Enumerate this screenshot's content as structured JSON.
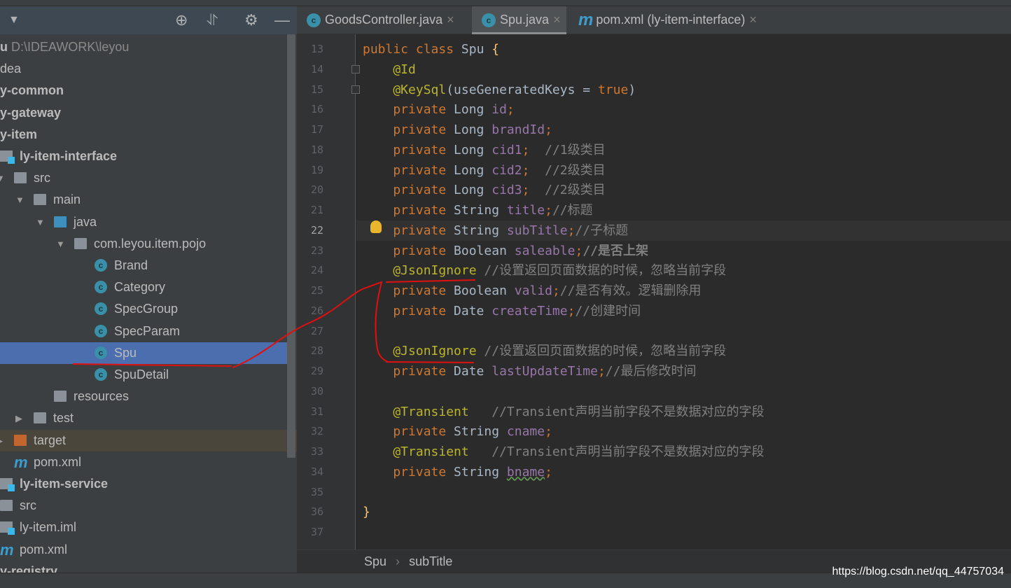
{
  "project_panel": {
    "tree": [
      {
        "depth": 0,
        "icon": "none",
        "parts": [
          {
            "text": "u",
            "s": "b"
          },
          {
            "text": " D:\\IDEAWORK\\leyou",
            "s": "g"
          }
        ]
      },
      {
        "depth": 0,
        "icon": "none",
        "parts": [
          {
            "text": "dea",
            "s": ""
          }
        ]
      },
      {
        "depth": 0,
        "icon": "none",
        "parts": [
          {
            "text": "y-common",
            "s": "b"
          }
        ]
      },
      {
        "depth": 0,
        "icon": "none",
        "parts": [
          {
            "text": "y-gateway",
            "s": "b"
          }
        ]
      },
      {
        "depth": 0,
        "icon": "none",
        "parts": [
          {
            "text": "y-item",
            "s": "b"
          }
        ]
      },
      {
        "depth": 1,
        "icon": "module",
        "parts": [
          {
            "text": "ly-item-interface",
            "s": "b"
          }
        ]
      },
      {
        "depth": 2,
        "icon": "folder",
        "arrow": "expanded",
        "parts": [
          {
            "text": "src",
            "s": ""
          }
        ]
      },
      {
        "depth": 3,
        "icon": "folder",
        "arrow": "expanded",
        "parts": [
          {
            "text": "main",
            "s": ""
          }
        ]
      },
      {
        "depth": 4,
        "icon": "folder-blue",
        "arrow": "expanded",
        "parts": [
          {
            "text": "java",
            "s": ""
          }
        ]
      },
      {
        "depth": 5,
        "icon": "package",
        "arrow": "expanded",
        "parts": [
          {
            "text": "com.leyou.item.pojo",
            "s": ""
          }
        ]
      },
      {
        "depth": 6,
        "icon": "class",
        "parts": [
          {
            "text": "Brand",
            "s": ""
          }
        ]
      },
      {
        "depth": 6,
        "icon": "class",
        "parts": [
          {
            "text": "Category",
            "s": ""
          }
        ]
      },
      {
        "depth": 6,
        "icon": "class",
        "parts": [
          {
            "text": "SpecGroup",
            "s": ""
          }
        ]
      },
      {
        "depth": 6,
        "icon": "class",
        "parts": [
          {
            "text": "SpecParam",
            "s": ""
          }
        ]
      },
      {
        "depth": 6,
        "icon": "class",
        "selected": true,
        "parts": [
          {
            "text": "Spu",
            "s": ""
          }
        ]
      },
      {
        "depth": 6,
        "icon": "class",
        "parts": [
          {
            "text": "SpuDetail",
            "s": ""
          }
        ]
      },
      {
        "depth": 4,
        "icon": "resources",
        "parts": [
          {
            "text": "resources",
            "s": ""
          }
        ]
      },
      {
        "depth": 3,
        "icon": "folder",
        "arrow": "collapsed",
        "parts": [
          {
            "text": "test",
            "s": ""
          }
        ]
      },
      {
        "depth": 2,
        "icon": "folder-orange",
        "arrow": "collapsed",
        "highlight": true,
        "parts": [
          {
            "text": "target",
            "s": ""
          }
        ]
      },
      {
        "depth": 2,
        "icon": "maven",
        "parts": [
          {
            "text": "pom.xml",
            "s": ""
          }
        ]
      },
      {
        "depth": 1,
        "icon": "module",
        "parts": [
          {
            "text": "ly-item-service",
            "s": "b"
          }
        ]
      },
      {
        "depth": 1,
        "icon": "folder",
        "parts": [
          {
            "text": "src",
            "s": ""
          }
        ]
      },
      {
        "depth": 1,
        "icon": "iml",
        "parts": [
          {
            "text": "ly-item.iml",
            "s": ""
          }
        ]
      },
      {
        "depth": 1,
        "icon": "maven",
        "parts": [
          {
            "text": "pom.xml",
            "s": ""
          }
        ]
      },
      {
        "depth": 0,
        "icon": "none",
        "parts": [
          {
            "text": "y-registry",
            "s": "b"
          }
        ]
      }
    ],
    "header_icons": [
      "dropdown-icon",
      "locate-icon",
      "collapse-all-icon",
      "gear-icon",
      "minimize-icon"
    ]
  },
  "tabs": [
    {
      "label": "GoodsController.java",
      "icon": "java-class-icon",
      "active": false
    },
    {
      "label": "Spu.java",
      "icon": "java-class-icon",
      "active": true
    },
    {
      "label": "pom.xml (ly-item-interface)",
      "icon": "maven-icon",
      "active": false
    }
  ],
  "editor": {
    "current_line": 22,
    "lines": [
      {
        "n": 13,
        "t": [
          [
            "kw",
            "public class "
          ],
          [
            "ty",
            "Spu "
          ],
          [
            "br",
            "{"
          ]
        ]
      },
      {
        "n": 14,
        "t": [
          [
            "an",
            "    @Id"
          ]
        ]
      },
      {
        "n": 15,
        "t": [
          [
            "an",
            "    @KeySql"
          ],
          [
            "ty",
            "(useGeneratedKeys = "
          ],
          [
            "kw",
            "true"
          ],
          [
            "ty",
            ")"
          ]
        ]
      },
      {
        "n": 16,
        "t": [
          [
            "kw",
            "    private "
          ],
          [
            "ty",
            "Long "
          ],
          [
            "fd",
            "id"
          ],
          [
            "pn",
            ";"
          ]
        ]
      },
      {
        "n": 17,
        "t": [
          [
            "kw",
            "    private "
          ],
          [
            "ty",
            "Long "
          ],
          [
            "fd",
            "brandId"
          ],
          [
            "pn",
            ";"
          ]
        ]
      },
      {
        "n": 18,
        "t": [
          [
            "kw",
            "    private "
          ],
          [
            "ty",
            "Long "
          ],
          [
            "fd",
            "cid1"
          ],
          [
            "pn",
            ";"
          ],
          [
            "cm",
            "  //1级类目"
          ]
        ]
      },
      {
        "n": 19,
        "t": [
          [
            "kw",
            "    private "
          ],
          [
            "ty",
            "Long "
          ],
          [
            "fd",
            "cid2"
          ],
          [
            "pn",
            ";"
          ],
          [
            "cm",
            "  //2级类目"
          ]
        ]
      },
      {
        "n": 20,
        "t": [
          [
            "kw",
            "    private "
          ],
          [
            "ty",
            "Long "
          ],
          [
            "fd",
            "cid3"
          ],
          [
            "pn",
            ";"
          ],
          [
            "cm",
            "  //2级类目"
          ]
        ]
      },
      {
        "n": 21,
        "t": [
          [
            "kw",
            "    private "
          ],
          [
            "ty",
            "String "
          ],
          [
            "fd",
            "title"
          ],
          [
            "pn",
            ";"
          ],
          [
            "cm",
            "//标题"
          ]
        ]
      },
      {
        "n": 22,
        "t": [
          [
            "kw",
            "    private "
          ],
          [
            "ty",
            "String "
          ],
          [
            "fd",
            "subTitle"
          ],
          [
            "pn",
            ";"
          ],
          [
            "cm",
            "//子标题"
          ]
        ]
      },
      {
        "n": 23,
        "t": [
          [
            "kw",
            "    private "
          ],
          [
            "ty",
            "Boolean "
          ],
          [
            "fd",
            "saleable"
          ],
          [
            "pn",
            ";"
          ],
          [
            "cmb",
            "//是否上架"
          ]
        ]
      },
      {
        "n": 24,
        "t": [
          [
            "an",
            "    @JsonIgnore "
          ],
          [
            "cm",
            "//设置返回页面数据的时候，忽略当前字段"
          ]
        ]
      },
      {
        "n": 25,
        "t": [
          [
            "kw",
            "    private "
          ],
          [
            "ty",
            "Boolean "
          ],
          [
            "fd",
            "valid"
          ],
          [
            "pn",
            ";"
          ],
          [
            "cm",
            "//是否有效。逻辑删除用"
          ]
        ]
      },
      {
        "n": 26,
        "t": [
          [
            "kw",
            "    private "
          ],
          [
            "ty",
            "Date "
          ],
          [
            "fd",
            "createTime"
          ],
          [
            "pn",
            ";"
          ],
          [
            "cm",
            "//创建时间"
          ]
        ]
      },
      {
        "n": 27,
        "t": []
      },
      {
        "n": 28,
        "t": [
          [
            "an",
            "    @JsonIgnore "
          ],
          [
            "cm",
            "//设置返回页面数据的时候，忽略当前字段"
          ]
        ]
      },
      {
        "n": 29,
        "t": [
          [
            "kw",
            "    private "
          ],
          [
            "ty",
            "Date "
          ],
          [
            "fd",
            "lastUpdateTime"
          ],
          [
            "pn",
            ";"
          ],
          [
            "cm",
            "//最后修改时间"
          ]
        ]
      },
      {
        "n": 30,
        "t": []
      },
      {
        "n": 31,
        "t": [
          [
            "an",
            "    @Transient   "
          ],
          [
            "cm",
            "//Transient声明当前字段不是数据对应的字段"
          ]
        ]
      },
      {
        "n": 32,
        "t": [
          [
            "kw",
            "    private "
          ],
          [
            "ty",
            "String "
          ],
          [
            "fd",
            "cname"
          ],
          [
            "pn",
            ";"
          ]
        ]
      },
      {
        "n": 33,
        "t": [
          [
            "an",
            "    @Transient   "
          ],
          [
            "cm",
            "//Transient声明当前字段不是数据对应的字段"
          ]
        ]
      },
      {
        "n": 34,
        "t": [
          [
            "kw",
            "    private "
          ],
          [
            "ty",
            "String "
          ],
          [
            "fd squig",
            "bname"
          ],
          [
            "pn",
            ";"
          ]
        ]
      },
      {
        "n": 35,
        "t": []
      },
      {
        "n": 36,
        "t": [
          [
            "br",
            "}"
          ]
        ]
      },
      {
        "n": 37,
        "t": []
      }
    ]
  },
  "breadcrumb": {
    "items": [
      "Spu",
      "subTitle"
    ],
    "separator": "›"
  },
  "watermark": "https://blog.csdn.net/qq_44757034",
  "colors": {
    "keyword": "#cc7832",
    "field": "#9876aa",
    "annotation": "#bbb529",
    "comment": "#808080",
    "selection": "#4b6eaf",
    "annotation_ink": "#e01010"
  }
}
